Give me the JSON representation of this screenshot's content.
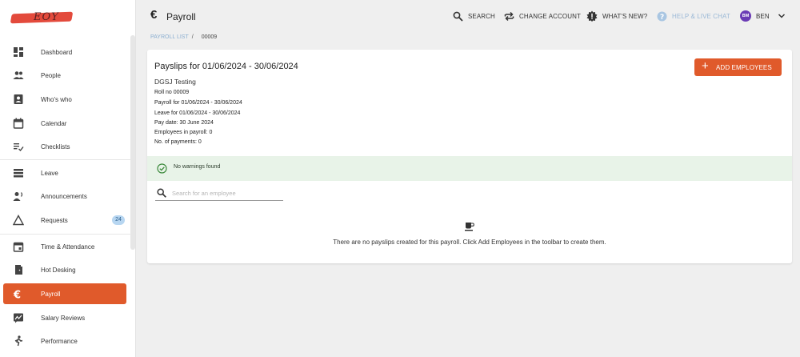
{
  "logo": {
    "text": "EOY"
  },
  "sidebar": {
    "items": [
      {
        "label": "Dashboard",
        "icon": "dashboard-icon"
      },
      {
        "label": "People",
        "icon": "people-icon"
      },
      {
        "label": "Who's who",
        "icon": "contact-card-icon"
      },
      {
        "label": "Calendar",
        "icon": "calendar-icon"
      },
      {
        "label": "Checklists",
        "icon": "checklist-icon"
      },
      {
        "label": "Leave",
        "icon": "leave-icon"
      },
      {
        "label": "Announcements",
        "icon": "announcement-icon"
      },
      {
        "label": "Requests",
        "icon": "triangle-icon",
        "badge": "24"
      },
      {
        "label": "Time & Attendance",
        "icon": "time-attendance-icon"
      },
      {
        "label": "Hot Desking",
        "icon": "door-icon"
      },
      {
        "label": "Payroll",
        "icon": "euro-icon"
      },
      {
        "label": "Salary Reviews",
        "icon": "salary-review-icon"
      },
      {
        "label": "Performance",
        "icon": "performance-icon"
      }
    ]
  },
  "header": {
    "title": "Payroll",
    "search": "SEARCH",
    "change_account": "CHANGE ACCOUNT",
    "whats_new": "WHAT'S NEW?",
    "help": "HELP & LIVE CHAT",
    "avatar_initials": "BM",
    "user": "BEN"
  },
  "breadcrumb": {
    "link": "PAYROLL LIST",
    "sep": "/",
    "current": "00009"
  },
  "card": {
    "title": "Payslips for 01/06/2024 - 30/06/2024",
    "add_button": "ADD EMPLOYEES",
    "company": "DGSJ Testing",
    "meta": [
      "Roll no 00009",
      "Payroll for 01/06/2024 - 30/06/2024",
      "Leave for 01/06/2024 - 30/06/2024",
      "Pay date: 30 June 2024",
      "Employees in payroll: 0",
      "No. of payments: 0"
    ],
    "warnings": "No warnings found",
    "search_placeholder": "Search for an employee",
    "empty_message": "There are no payslips created for this payroll. Click Add Employees in the toolbar to create them."
  },
  "colors": {
    "accent": "#e05a2b",
    "success_bg": "#e8f3e8",
    "badge_bg": "#b7d6f1",
    "avatar": "#6a3bb5"
  }
}
